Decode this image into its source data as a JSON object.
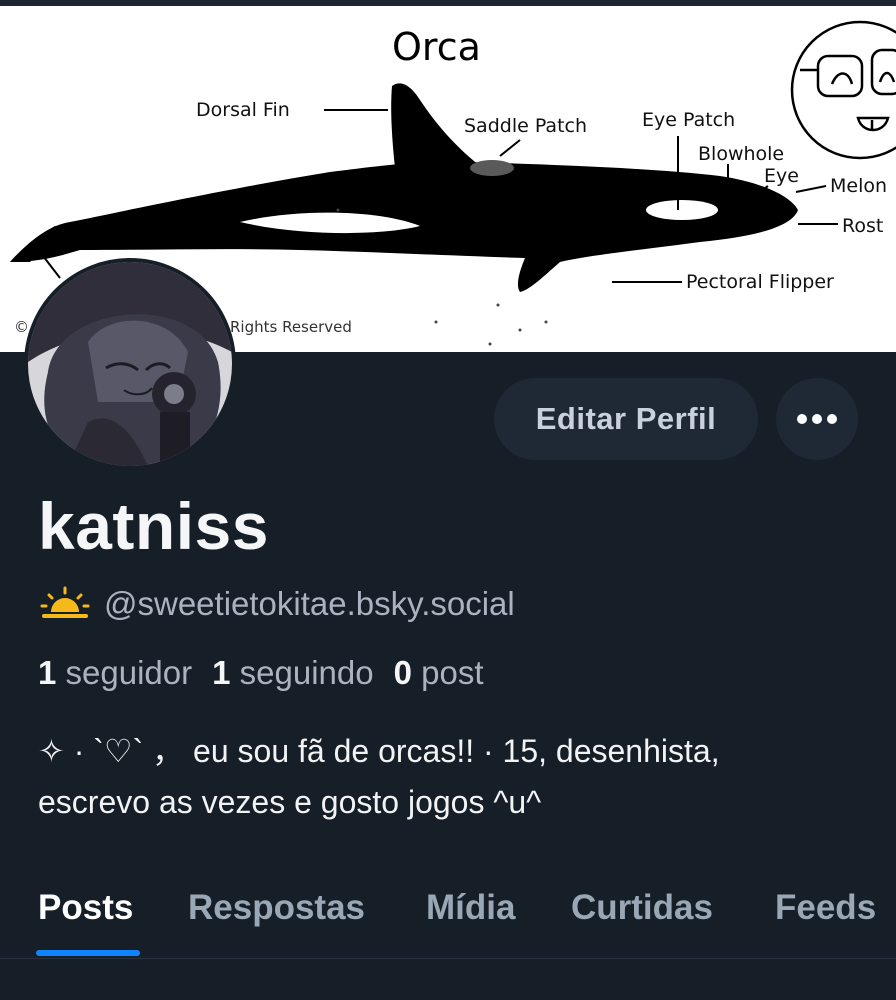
{
  "banner": {
    "title": "Orca",
    "labels": {
      "dorsal_fin": "Dorsal Fin",
      "saddle_patch": "Saddle Patch",
      "eye_patch": "Eye Patch",
      "blowhole": "Blowhole",
      "eye": "Eye",
      "melon": "Melon",
      "rostrum": "Rost",
      "pectoral_flipper": "Pectoral Flipper",
      "copyright": "Rights Reserved",
      "copyright_symbol": "©"
    }
  },
  "profile": {
    "display_name": "katniss",
    "handle_icon": "sunrise-icon",
    "handle": "@sweetietokitae.bsky.social",
    "followers_count": "1",
    "followers_label": "seguidor",
    "following_count": "1",
    "following_label": "seguindo",
    "posts_count": "0",
    "posts_label": "post",
    "bio_line1": "✧ · `♡` ， eu sou fã de orcas!! · 15, desenhista,",
    "bio_line2": "escrevo as vezes e gosto jogos ^u^"
  },
  "actions": {
    "edit_profile": "Editar Perfil",
    "more_icon": "ellipsis-icon"
  },
  "tabs": [
    {
      "label": "Posts",
      "active": true
    },
    {
      "label": "Respostas",
      "active": false
    },
    {
      "label": "Mídia",
      "active": false
    },
    {
      "label": "Curtidas",
      "active": false
    },
    {
      "label": "Feeds",
      "active": false
    }
  ],
  "colors": {
    "background": "#161e27",
    "accent": "#1083fe",
    "button_bg": "#1e2935",
    "muted_text": "#aab4c0"
  }
}
